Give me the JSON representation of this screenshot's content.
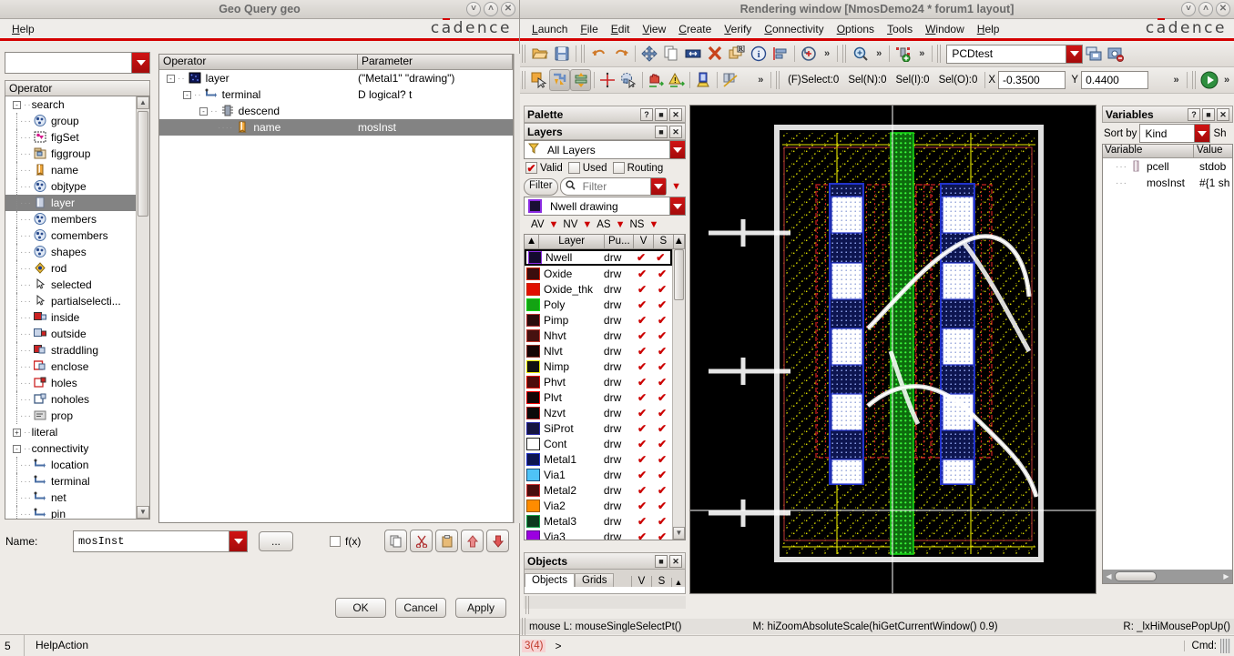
{
  "geo_window": {
    "title": "Geo Query geo",
    "menu": [
      "Help"
    ],
    "brand": "cadence",
    "top_combo_value": "",
    "operator_panel_label": "Operator",
    "tree": [
      {
        "label": "search",
        "icon": "search-folder-icon",
        "depth": 0,
        "expander": "-"
      },
      {
        "label": "group",
        "icon": "group-icon",
        "depth": 1
      },
      {
        "label": "figSet",
        "icon": "figset-icon",
        "depth": 1
      },
      {
        "label": "figgroup",
        "icon": "figgroup-icon",
        "depth": 1
      },
      {
        "label": "name",
        "icon": "name-icon",
        "depth": 1
      },
      {
        "label": "objtype",
        "icon": "objtype-icon",
        "depth": 1
      },
      {
        "label": "layer",
        "icon": "layer-icon",
        "depth": 1,
        "selected": true
      },
      {
        "label": "members",
        "icon": "members-icon",
        "depth": 1
      },
      {
        "label": "comembers",
        "icon": "comembers-icon",
        "depth": 1
      },
      {
        "label": "shapes",
        "icon": "shapes-icon",
        "depth": 1
      },
      {
        "label": "rod",
        "icon": "rod-icon",
        "depth": 1
      },
      {
        "label": "selected",
        "icon": "selected-icon",
        "depth": 1
      },
      {
        "label": "partialselecti...",
        "icon": "partialselection-icon",
        "depth": 1
      },
      {
        "label": "inside",
        "icon": "inside-icon",
        "depth": 1
      },
      {
        "label": "outside",
        "icon": "outside-icon",
        "depth": 1
      },
      {
        "label": "straddling",
        "icon": "straddling-icon",
        "depth": 1
      },
      {
        "label": "enclose",
        "icon": "enclose-icon",
        "depth": 1
      },
      {
        "label": "holes",
        "icon": "holes-icon",
        "depth": 1
      },
      {
        "label": "noholes",
        "icon": "noholes-icon",
        "depth": 1
      },
      {
        "label": "prop",
        "icon": "prop-icon",
        "depth": 1
      },
      {
        "label": "literal",
        "icon": "",
        "depth": 0,
        "expander": "+"
      },
      {
        "label": "connectivity",
        "icon": "",
        "depth": 0,
        "expander": "-"
      },
      {
        "label": "location",
        "icon": "connect-icon",
        "depth": 1
      },
      {
        "label": "terminal",
        "icon": "connect-icon",
        "depth": 1
      },
      {
        "label": "net",
        "icon": "connect-icon",
        "depth": 1
      },
      {
        "label": "pin",
        "icon": "connect-icon",
        "depth": 1
      }
    ],
    "operator_table": {
      "columns": [
        "Operator",
        "Parameter"
      ],
      "rows": [
        {
          "operator": "layer",
          "parameter": "(\"Metal1\" \"drawing\")",
          "icon": "layer-swatch-icon",
          "indent": 0,
          "expander": "-"
        },
        {
          "operator": "terminal",
          "parameter": "D logical? t",
          "icon": "connect-icon",
          "indent": 1,
          "expander": "-"
        },
        {
          "operator": "descend",
          "parameter": "",
          "icon": "descend-icon",
          "indent": 2,
          "expander": "-"
        },
        {
          "operator": "name",
          "parameter": "mosInst",
          "icon": "name-icon",
          "indent": 3,
          "expander": "",
          "selected": true
        }
      ]
    },
    "name_row": {
      "label": "Name:",
      "value": "mosInst",
      "ellipsis_button": "...",
      "fx_label": "f(x)",
      "fx_checked": false,
      "icon_buttons": [
        "copy-icon",
        "cut-icon",
        "paste-icon",
        "move-up-icon",
        "move-down-icon"
      ]
    },
    "action_buttons": [
      "OK",
      "Cancel",
      "Apply"
    ],
    "statusbar": {
      "count": "5",
      "message": "HelpAction"
    }
  },
  "rendering_window": {
    "title": "Rendering window [NmosDemo24 * forum1 layout]",
    "menu": [
      "Launch",
      "File",
      "Edit",
      "View",
      "Create",
      "Verify",
      "Connectivity",
      "Options",
      "Tools",
      "Window",
      "Help"
    ],
    "brand": "cadence",
    "toolbar1": {
      "icons": [
        "open-icon",
        "save-icon",
        "undo-icon",
        "redo-icon",
        "move-icon",
        "copy-icon",
        "stretch-icon",
        "delete-icon",
        "replicate-icon",
        "property-info-icon",
        "align-icon",
        "undo-history-icon"
      ],
      "overflow": "»",
      "zoom_icon": "zoom-in-icon",
      "hier_icon": "add-instance-icon",
      "library_value": "PCDtest",
      "right_icons": [
        "save-hierarchy-icon",
        "clear-ruler-icon"
      ]
    },
    "toolbar2": {
      "icons": [
        "select-object-icon",
        "partial-select-icon",
        "hier-edit-icon",
        "ruler-icon",
        "deselect-icon",
        "stop-icon",
        "warning-icon",
        "pin-icon",
        "measure-icon"
      ],
      "overflow": "»",
      "selection_status": [
        "(F)Select:0",
        "Sel(N):0",
        "Sel(I):0",
        "Sel(O):0"
      ],
      "x_label": "X",
      "x_value": "-0.3500",
      "y_label": "Y",
      "y_value": "0.4400",
      "run_icon": "run-icon"
    },
    "palette": {
      "title": "Palette",
      "layers_title": "Layers",
      "filter_select": "All Layers",
      "checks": [
        {
          "label": "Valid",
          "checked": true
        },
        {
          "label": "Used",
          "checked": false
        },
        {
          "label": "Routing",
          "checked": false
        }
      ],
      "filter_button": "Filter",
      "filter_placeholder": "Filter",
      "current_layer": "Nwell drawing",
      "current_layer_color": "#1a0f33",
      "mode_buttons": [
        "AV",
        "NV",
        "AS",
        "NS"
      ],
      "columns": [
        "Layer",
        "Pu...",
        "V",
        "S"
      ],
      "layers": [
        {
          "name": "Nwell",
          "purpose": "drw",
          "v": true,
          "s": true,
          "color": "#140a2e",
          "border": "#8b2be2",
          "selected": true
        },
        {
          "name": "Oxide",
          "purpose": "drw",
          "v": true,
          "s": true,
          "color": "#3a0d0d",
          "border": "#cc2200"
        },
        {
          "name": "Oxide_thk",
          "purpose": "drw",
          "v": true,
          "s": true,
          "color": "#e01000",
          "border": "#cc2200"
        },
        {
          "name": "Poly",
          "purpose": "drw",
          "v": true,
          "s": true,
          "color": "#13a313",
          "border": "#16d616"
        },
        {
          "name": "Pimp",
          "purpose": "drw",
          "v": true,
          "s": true,
          "color": "#2a0c0c",
          "border": "#b03030"
        },
        {
          "name": "Nhvt",
          "purpose": "drw",
          "v": true,
          "s": true,
          "color": "#46110f",
          "border": "#c03a30"
        },
        {
          "name": "Nlvt",
          "purpose": "drw",
          "v": true,
          "s": true,
          "color": "#140505",
          "border": "#8c3028"
        },
        {
          "name": "Nimp",
          "purpose": "drw",
          "v": true,
          "s": true,
          "color": "#121212",
          "border": "#e8e800"
        },
        {
          "name": "Phvt",
          "purpose": "drw",
          "v": true,
          "s": true,
          "color": "#4d0b0b",
          "border": "#e01000"
        },
        {
          "name": "Plvt",
          "purpose": "drw",
          "v": true,
          "s": true,
          "color": "#130505",
          "border": "#ee0000"
        },
        {
          "name": "Nzvt",
          "purpose": "drw",
          "v": true,
          "s": true,
          "color": "#0a0a0a",
          "border": "#b22222"
        },
        {
          "name": "SiProt",
          "purpose": "drw",
          "v": true,
          "s": true,
          "color": "#151540",
          "border": "#2a2aa8"
        },
        {
          "name": "Cont",
          "purpose": "drw",
          "v": true,
          "s": true,
          "color": "#ffffff",
          "border": "#222222"
        },
        {
          "name": "Metal1",
          "purpose": "drw",
          "v": true,
          "s": true,
          "color": "#0d1550",
          "border": "#2233cc"
        },
        {
          "name": "Via1",
          "purpose": "drw",
          "v": true,
          "s": true,
          "color": "#4fc3f7",
          "border": "#1a4f7a"
        },
        {
          "name": "Metal2",
          "purpose": "drw",
          "v": true,
          "s": true,
          "color": "#4a0d0d",
          "border": "#cc3333"
        },
        {
          "name": "Via2",
          "purpose": "drw",
          "v": true,
          "s": true,
          "color": "#ff8c00",
          "border": "#a05a00"
        },
        {
          "name": "Metal3",
          "purpose": "drw",
          "v": true,
          "s": true,
          "color": "#0c3a1e",
          "border": "#16a34a"
        },
        {
          "name": "Via3",
          "purpose": "drw",
          "v": true,
          "s": true,
          "color": "#9b00e0",
          "border": "#5e0090"
        }
      ]
    },
    "objects_panel": {
      "title": "Objects",
      "tabs": [
        "Objects",
        "Grids"
      ],
      "active_tab": "Objects",
      "columns": [
        "V",
        "S"
      ]
    },
    "variables_panel": {
      "title": "Variables",
      "sort_by_label": "Sort by",
      "sort_by_value": "Kind",
      "show_label": "Sh",
      "columns": [
        "Variable",
        "Value"
      ],
      "rows": [
        {
          "variable": "pcell",
          "value": "stdob",
          "icon": "pcell-icon"
        },
        {
          "variable": "mosInst",
          "value": "#{1 sh",
          "icon": ""
        }
      ]
    },
    "status": {
      "mouse_left": "mouse L: mouseSingleSelectPt()",
      "mouse_middle": "M: hiZoomAbsoluteScale(hiGetCurrentWindow() 0.9)",
      "mouse_right": "R: _lxHiMousePopUp()",
      "prompt_count": "3(4)",
      "prompt": ">",
      "cmd_label": "Cmd:"
    }
  },
  "colors": {
    "brand_red": "#d40000",
    "titlebar_text": "#6a6a6a",
    "selection_gray": "#838383",
    "canvas_bg": "#000000"
  }
}
